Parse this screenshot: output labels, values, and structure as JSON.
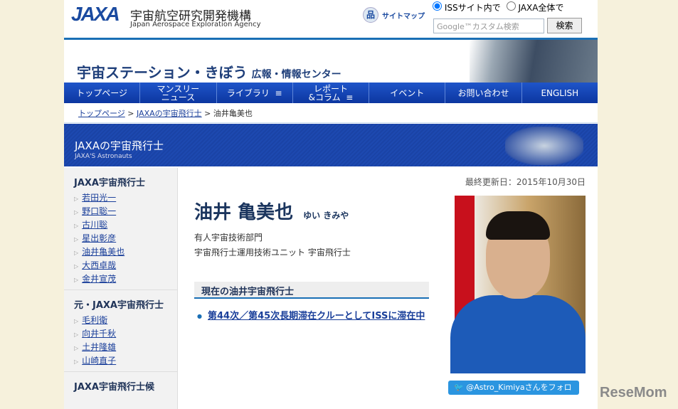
{
  "header": {
    "logo": "JAXA",
    "org_name": "宇宙航空研究開発機構",
    "org_name_en": "Japan Aerospace Exploration Agency",
    "sitemap": "サイトマップ",
    "radio_iss": "ISSサイト内で",
    "radio_jaxa": "JAXA全体で",
    "search_placeholder": "Google™カスタム検索",
    "search_button": "検索"
  },
  "banner": {
    "title": "宇宙ステーション・きぼう",
    "subtitle": "広報・情報センター"
  },
  "nav": [
    "トップページ",
    "マンスリー\nニュース",
    "ライブラリ  ≡",
    "レポート\n&コラム  ≡",
    "イベント",
    "お問い合わせ",
    "ENGLISH"
  ],
  "breadcrumb": {
    "home": "トップページ",
    "section": "JAXAの宇宙飛行士",
    "current": "油井亀美也"
  },
  "section": {
    "title": "JAXAの宇宙飛行士",
    "title_en": "JAXA'S Astronauts"
  },
  "sidebar": {
    "group1": {
      "heading": "JAXA宇宙飛行士",
      "items": [
        "若田光一",
        "野口聡一",
        "古川聡",
        "星出彰彦",
        "油井亀美也",
        "大西卓哉",
        "金井宣茂"
      ]
    },
    "group2": {
      "heading": "元・JAXA宇宙飛行士",
      "items": [
        "毛利衛",
        "向井千秋",
        "土井隆雄",
        "山崎直子"
      ]
    },
    "group3": {
      "heading": "JAXA宇宙飛行士候"
    }
  },
  "main": {
    "updated": "最終更新日：2015年10月30日",
    "name": "油井 亀美也",
    "reading": "ゆい きみや",
    "dept1": "有人宇宙技術部門",
    "dept2": "宇宙飛行士運用技術ユニット 宇宙飛行士",
    "current_heading": "現在の油井宇宙飛行士",
    "current_link": "第44次／第45次長期滞在クルーとしてISSに滞在中",
    "twitter": "@Astro_Kimiyaさんをフォロー"
  },
  "watermark": "ReseMom"
}
